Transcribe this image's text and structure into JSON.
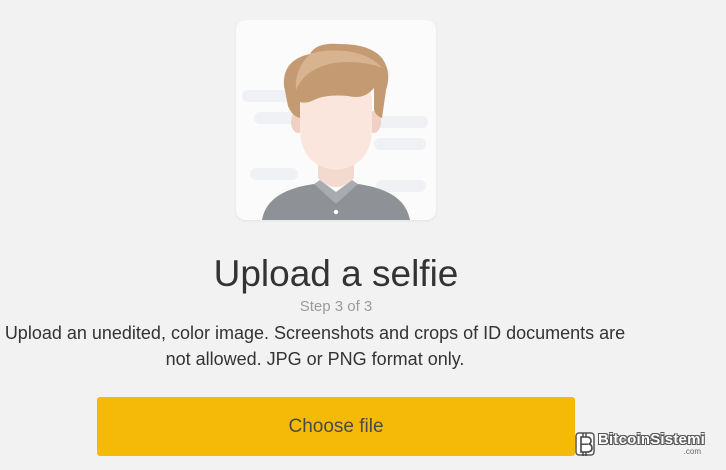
{
  "upload": {
    "title": "Upload a selfie",
    "step": "Step 3 of 3",
    "description": "Upload an unedited, color image. Screenshots and crops of ID documents are not allowed. JPG or PNG format only.",
    "button_label": "Choose file",
    "illustration_icon": "selfie-avatar-icon"
  },
  "watermark": {
    "brand": "BitcoinSistemi",
    "domain": ".com"
  },
  "colors": {
    "background": "#f2f2f2",
    "button": "#f5ba08",
    "title_text": "#333333",
    "step_text": "#9a9a9a",
    "card": "#fbfbfc"
  }
}
